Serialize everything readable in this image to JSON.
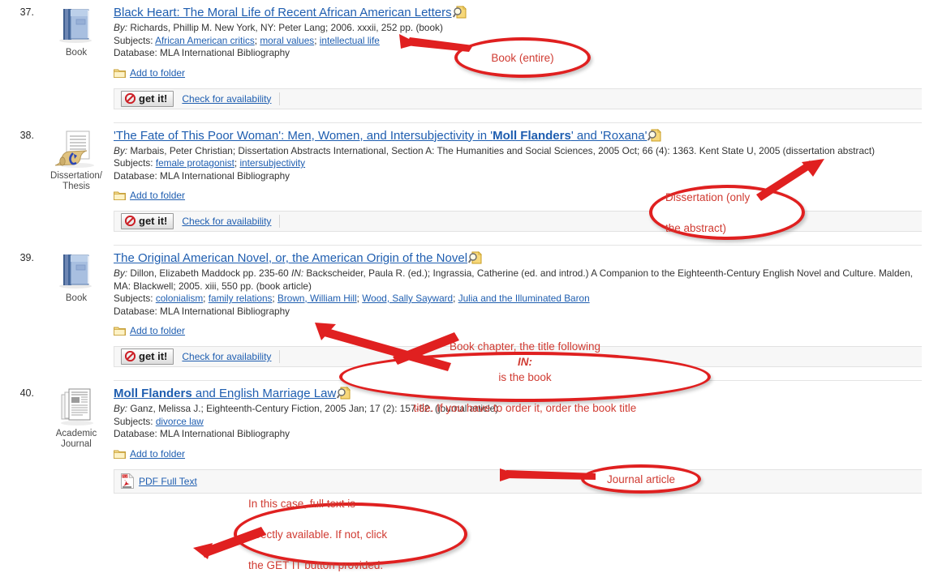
{
  "results": [
    {
      "number": "37.",
      "type_label": "Book",
      "type_icon": "book-icon",
      "title": "Black Heart: The Moral Life of Recent African American Letters",
      "title_bold_prefix": "",
      "by": "By: Richards, Phillip M. New York, NY: Peter Lang; 2006. xxxii, 252 pp. (book)",
      "by_prefix": "By:",
      "subjects_label": "Subjects:",
      "subjects": "African American critics; moral values; intellectual life",
      "database_label": "Database:",
      "database": "MLA International Bibliography",
      "add_to_folder": "Add to folder",
      "link_type": "getit",
      "getit_label": "get it!",
      "check_label": "Check for availability"
    },
    {
      "number": "38.",
      "type_label": "Dissertation/ Thesis",
      "type_icon": "dissertation-icon",
      "title": "'The Fate of This Poor Woman': Men, Women, and Intersubjectivity in 'Moll Flanders' and 'Roxana'",
      "by": "By: Marbais, Peter Christian; Dissertation Abstracts International, Section A: The Humanities and Social Sciences, 2005 Oct; 66 (4): 1363. Kent State U, 2005 (dissertation abstract)",
      "by_prefix": "By:",
      "subjects_label": "Subjects:",
      "subjects": "female protagonist; intersubjectivity",
      "database_label": "Database:",
      "database": "MLA International Bibliography",
      "add_to_folder": "Add to folder",
      "link_type": "getit",
      "getit_label": "get it!",
      "check_label": "Check for availability"
    },
    {
      "number": "39.",
      "type_label": "Book",
      "type_icon": "book-icon",
      "title": "The Original American Novel, or, the American Origin of the Novel",
      "by": "By: Dillon, Elizabeth Maddock pp. 235-60 IN: Backscheider, Paula R. (ed.); Ingrassia, Catherine (ed. and introd.) A Companion to the Eighteenth-Century English Novel and Culture. Malden, MA: Blackwell; 2005. xiii, 550 pp. (book article)",
      "by_prefix": "By:",
      "subjects_label": "Subjects:",
      "subjects": "colonialism; family relations; Brown, William Hill; Wood, Sally Sayward; Julia and the Illuminated Baron",
      "database_label": "Database:",
      "database": "MLA International Bibliography",
      "add_to_folder": "Add to folder",
      "link_type": "getit",
      "getit_label": "get it!",
      "check_label": "Check for availability"
    },
    {
      "number": "40.",
      "type_label": "Academic Journal",
      "type_icon": "academic-journal-icon",
      "title": "Moll Flanders and English Marriage Law",
      "title_bold_prefix": "Moll Flanders",
      "title_rest": " and English Marriage Law",
      "by": "By: Ganz, Melissa J.; Eighteenth-Century Fiction, 2005 Jan; 17 (2): 157-82. (journal article)",
      "by_prefix": "By:",
      "subjects_label": "Subjects:",
      "subjects": "divorce law",
      "database_label": "Database:",
      "database": "MLA International Bibliography",
      "add_to_folder": "Add to folder",
      "link_type": "pdf",
      "pdf_label": "PDF Full Text"
    }
  ],
  "annotations": [
    {
      "id": "annot-book-entire",
      "text": "Book (entire)"
    },
    {
      "id": "annot-dissertation",
      "line1": "Dissertation (only",
      "line2": "the abstract)"
    },
    {
      "id": "annot-book-chapter",
      "line1_a": "Book chapter, the title following ",
      "line1_em": "IN:",
      "line1_b": " is the book",
      "line2": "title. If you have to order it, order the book title"
    },
    {
      "id": "annot-journal-article",
      "text": "Journal article"
    },
    {
      "id": "annot-full-text",
      "line1": "In this case, full text is",
      "line2": "directly available. If not, click",
      "line3": "the GET IT button provided."
    }
  ],
  "colors": {
    "link": "#1f5eb0",
    "annotation_red": "#e02020",
    "annotation_text": "#d03b32",
    "bar_background": "#f7f7f7"
  }
}
